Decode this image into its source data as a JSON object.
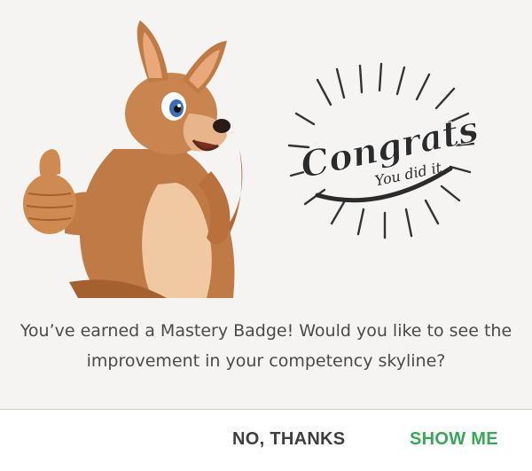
{
  "dialog": {
    "message": "You’ve earned a Mastery Badge! Would you like to see the improvement in your competency skyline?",
    "buttons": {
      "no_thanks_label": "NO, THANKS",
      "show_me_label": "SHOW ME"
    },
    "lettering": {
      "congrats": "Congrats!",
      "you_did_it": "You did it"
    }
  },
  "colors": {
    "dialog_background": "#f5f4f2",
    "primary_action": "#3aa65a",
    "secondary_action": "#3e3e3e",
    "message_text": "#4a4a4a"
  },
  "icons": {
    "mascot": "kangaroo-thumbs-up-icon",
    "badge_art": "congrats-lettering-icon"
  }
}
